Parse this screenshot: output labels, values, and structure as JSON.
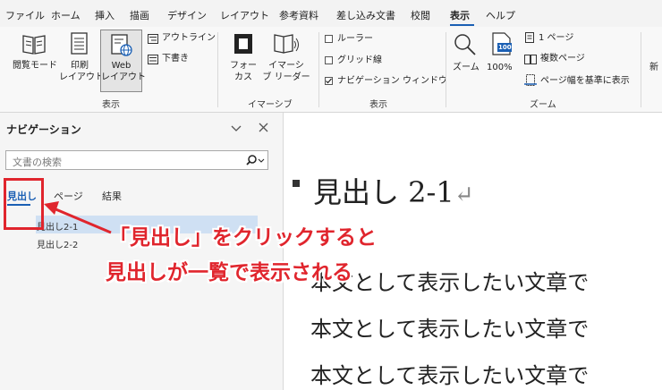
{
  "menu": {
    "items": [
      "ファイル",
      "ホーム",
      "挿入",
      "描画",
      "デザイン",
      "レイアウト",
      "参考資料",
      "差し込み文書",
      "校閲",
      "表示",
      "ヘルプ"
    ],
    "active": "表示"
  },
  "ribbon": {
    "views": {
      "read_mode": "閲覧モード",
      "print_layout_1": "印刷",
      "print_layout_2": "レイアウト",
      "web_layout_1": "Web",
      "web_layout_2": "レイアウト",
      "outline": "アウトライン",
      "draft": "下書き",
      "group_label": "表示"
    },
    "immersive": {
      "focus_1": "フォー",
      "focus_2": "カス",
      "reader_1": "イマーシ",
      "reader_2": "ブ リーダー",
      "group_label": "イマーシブ"
    },
    "show": {
      "ruler": "ルーラー",
      "gridlines": "グリッド線",
      "nav_pane": "ナビゲーション ウィンドウ",
      "nav_pane_checked": true,
      "group_label": "表示"
    },
    "zoom": {
      "zoom": "ズーム",
      "hundred": "100%",
      "hundred_icon": "100",
      "one_page": "1 ページ",
      "multiple_pages": "複数ページ",
      "page_width": "ページ幅を基準に表示",
      "group_label": "ズーム"
    },
    "new_window_partial": "新"
  },
  "nav_pane": {
    "title": "ナビゲーション",
    "search_placeholder": "文書の検索",
    "tabs": [
      "見出し",
      "ページ",
      "結果"
    ],
    "headings": [
      "見出し2-1",
      "見出し2-2"
    ]
  },
  "document": {
    "heading": "見出し 2-1",
    "return_mark": "↵",
    "body_lines": [
      "本文として表示したい文章で",
      "本文として表示したい文章で",
      "本文として表示したい文章で"
    ]
  },
  "annotation": {
    "line1": "「見出し」をクリックすると",
    "line2": "見出しが一覧で表示される",
    "color": "#e0252d"
  }
}
